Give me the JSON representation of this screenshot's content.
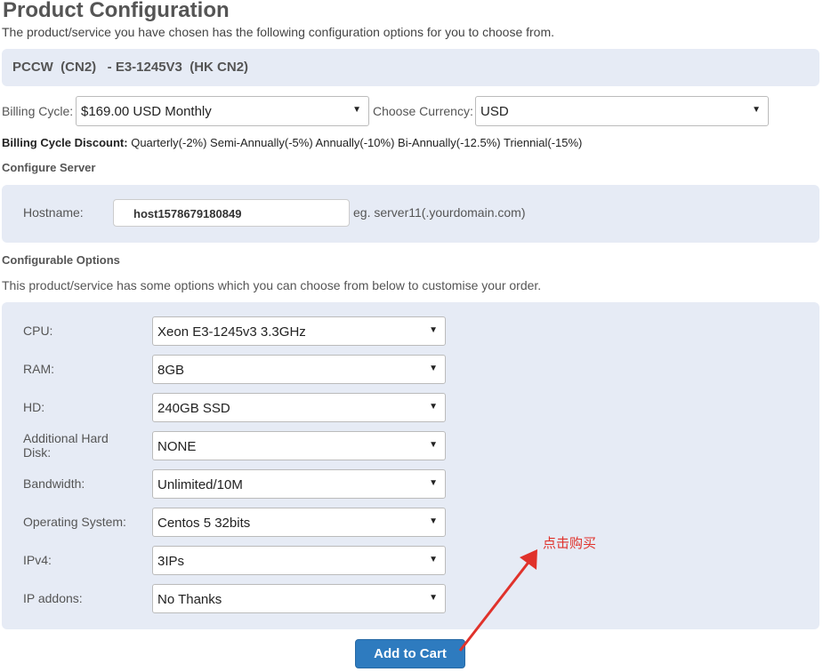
{
  "header": {
    "title": "Product Configuration",
    "intro": "The product/service you have chosen has the following configuration options for you to choose from."
  },
  "product": {
    "name": "PCCW  (CN2)   - E3-1245V3  (HK CN2)"
  },
  "billing": {
    "cycle_label": "Billing Cycle:",
    "cycle_value": "$169.00 USD Monthly",
    "currency_label": "Choose Currency:",
    "currency_value": "USD"
  },
  "discount": {
    "label": "Billing Cycle Discount:",
    "text": "Quarterly(-2%) Semi-Annually(-5%) Annually(-10%) Bi-Annually(-12.5%) Triennial(-15%)"
  },
  "server": {
    "heading": "Configure Server",
    "hostname_label": "Hostname:",
    "hostname_value": "host1578679180849",
    "hostname_hint": "eg. server11(.yourdomain.com)"
  },
  "options": {
    "heading": "Configurable Options",
    "description": "This product/service has some options which you can choose from below to customise your order.",
    "items": [
      {
        "label": "CPU:",
        "value": "Xeon E3-1245v3 3.3GHz"
      },
      {
        "label": "RAM:",
        "value": "8GB"
      },
      {
        "label": "HD:",
        "value": "240GB SSD"
      },
      {
        "label": "Additional Hard Disk:",
        "value": "NONE"
      },
      {
        "label": "Bandwidth:",
        "value": "Unlimited/10M"
      },
      {
        "label": "Operating System:",
        "value": "Centos 5 32bits"
      },
      {
        "label": "IPv4:",
        "value": "3IPs"
      },
      {
        "label": "IP addons:",
        "value": "No Thanks"
      }
    ]
  },
  "actions": {
    "add_to_cart": "Add to Cart"
  },
  "annotation": {
    "text": "点击购买",
    "color": "#e0322b"
  },
  "icons": {
    "select_caret": "▼"
  },
  "colors": {
    "panel_bg": "#e6ebf5",
    "button_bg": "#2e7bbf"
  }
}
